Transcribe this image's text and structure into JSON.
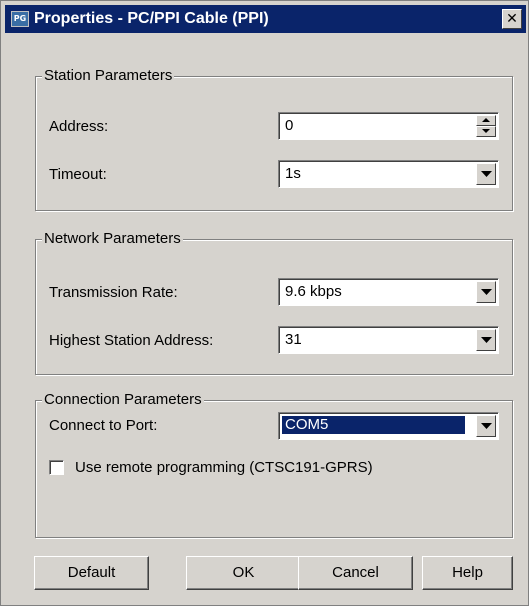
{
  "window": {
    "title": "Properties - PC/PPI Cable (PPI)",
    "app_icon_text": "PG"
  },
  "station": {
    "legend": "Station Parameters",
    "address_label": "Address:",
    "address_value": "0",
    "timeout_label": "Timeout:",
    "timeout_value": "1s"
  },
  "network": {
    "legend": "Network Parameters",
    "rate_label": "Transmission Rate:",
    "rate_value": "9.6 kbps",
    "highest_label": "Highest Station Address:",
    "highest_value": "31"
  },
  "connection": {
    "legend": "Connection Parameters",
    "port_label": "Connect to Port:",
    "port_value": "COM5",
    "remote_label": "Use remote programming (CTSC191-GPRS)",
    "remote_checked": false
  },
  "buttons": {
    "default": "Default",
    "ok": "OK",
    "cancel": "Cancel",
    "help": "Help"
  },
  "colors": {
    "titlebar": "#0a246a",
    "dialog_face": "#d6d3ce",
    "selection": "#0a246a"
  },
  "icons": {
    "close": "close-icon",
    "dropdown": "chevron-down-icon",
    "spin_up": "spin-up-icon",
    "spin_down": "spin-down-icon"
  }
}
